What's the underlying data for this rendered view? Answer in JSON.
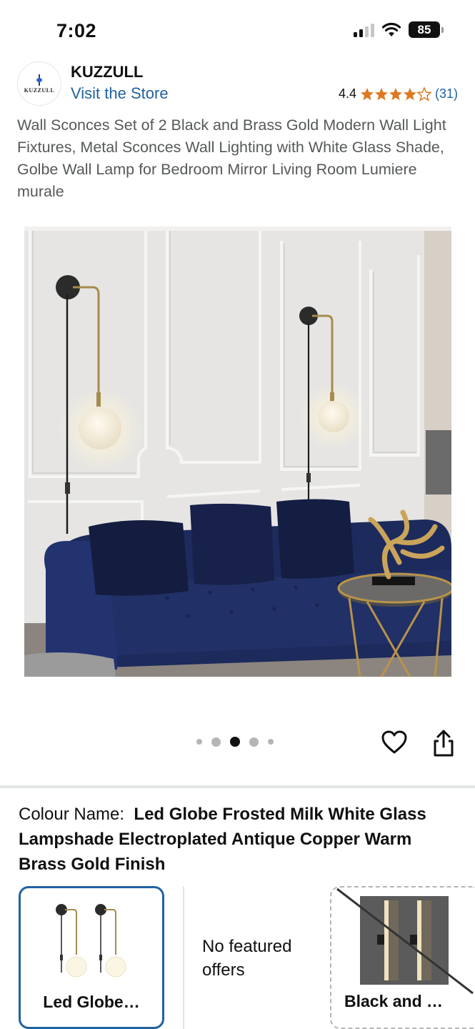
{
  "status_bar": {
    "time": "7:02",
    "battery": "85"
  },
  "store": {
    "logo_text": "KUZZULL",
    "name": "KUZZULL",
    "visit_label": "Visit the Store",
    "rating_value": "4.4",
    "stars": 4.4,
    "review_count": "(31)",
    "star_color": "#de7921",
    "link_color": "#2162a1"
  },
  "product": {
    "title": "Wall Sconces Set of 2 Black and Brass Gold Modern Wall Light Fixtures, Metal Sconces Wall Lighting with White Glass Shade, Golbe Wall Lamp for Bedroom Mirror Living Room Lumiere murale",
    "image_index": 3,
    "image_count": 5
  },
  "colour": {
    "label": "Colour Name:",
    "value": "Led Globe Frosted Milk White Glass Lampshade Electroplated Antique Copper Warm Brass Gold Finish"
  },
  "variants": [
    {
      "label": "Led Globe…",
      "selected": true
    },
    {
      "label": "No featured offers"
    },
    {
      "label": "Black and …",
      "unavailable": true
    }
  ]
}
